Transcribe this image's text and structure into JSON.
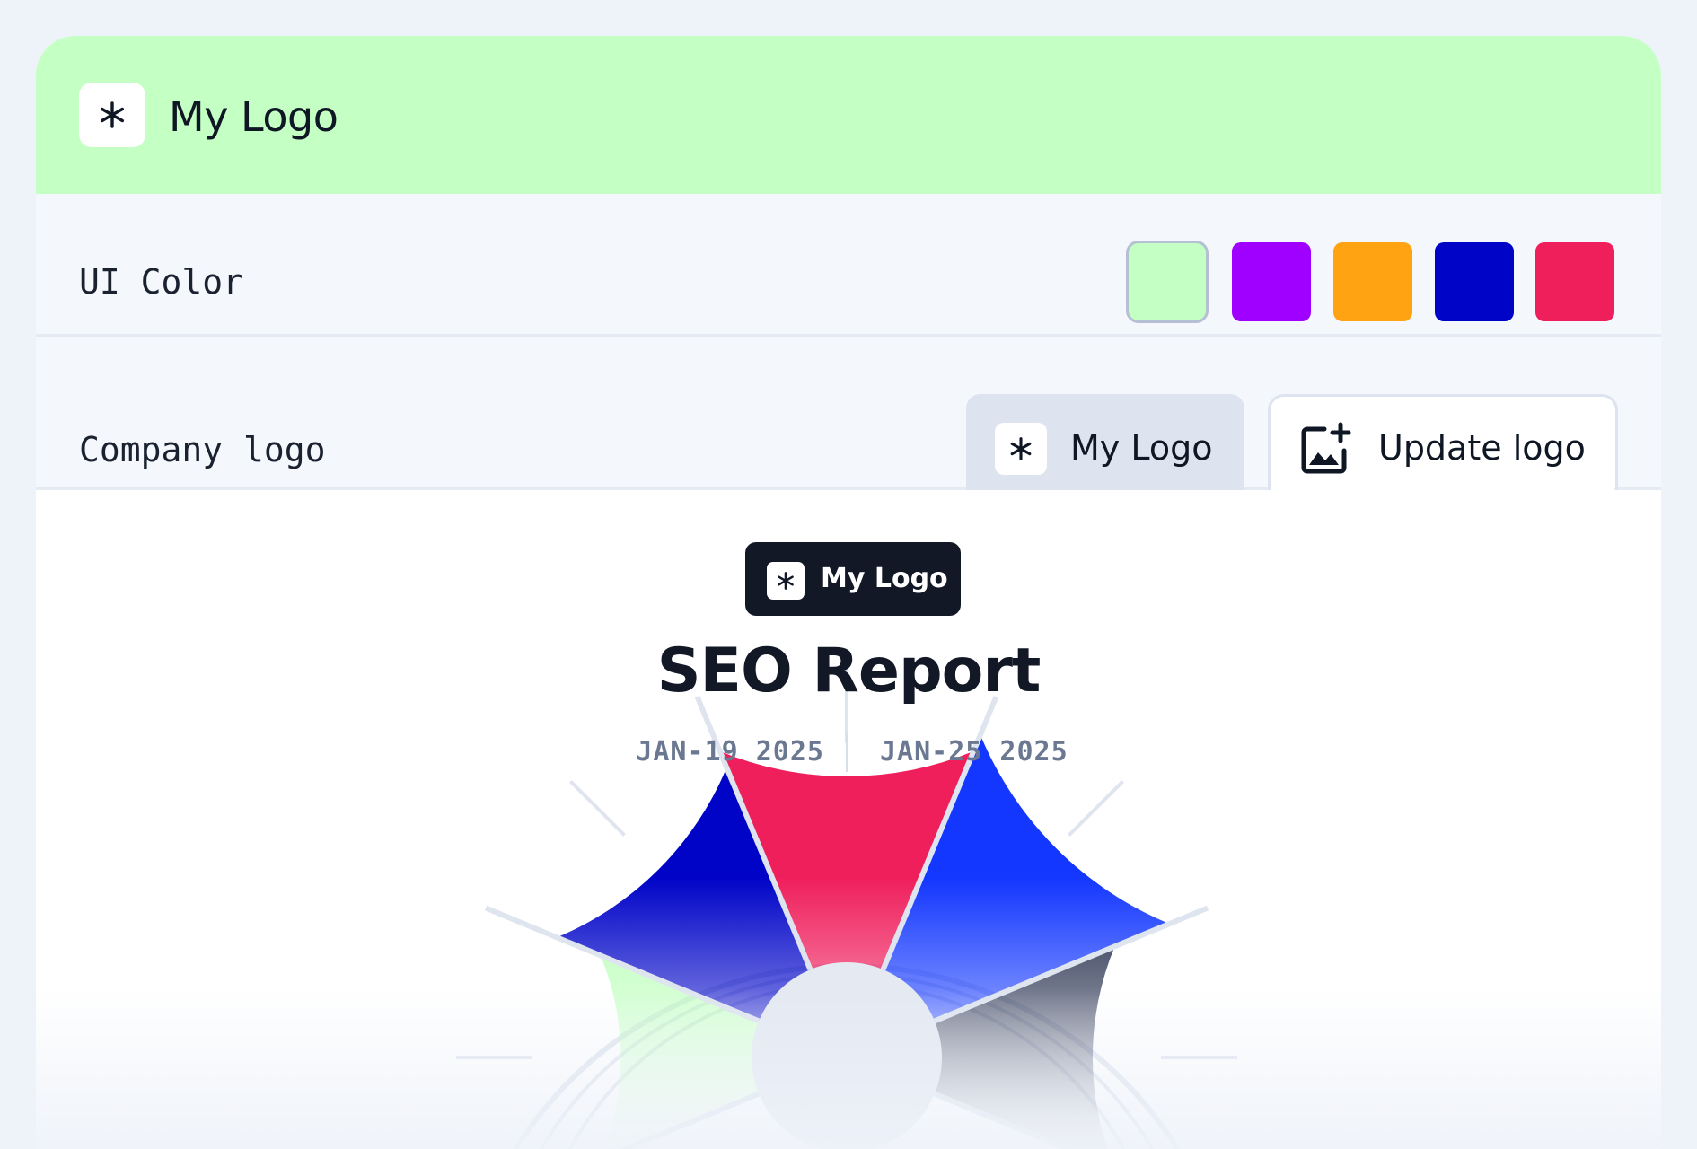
{
  "header": {
    "logo_icon": "asterisk-icon",
    "title": "My Logo",
    "background": "#c4ffc4"
  },
  "ui_color": {
    "label": "UI Color",
    "swatches": [
      {
        "color": "#c4ffc4",
        "selected": true
      },
      {
        "color": "#a000ff",
        "selected": false
      },
      {
        "color": "#ffa313",
        "selected": false
      },
      {
        "color": "#0004c7",
        "selected": false
      },
      {
        "color": "#ef1f5c",
        "selected": false
      }
    ]
  },
  "company_logo": {
    "label": "Company logo",
    "current_logo_label": "My Logo",
    "update_button_label": "Update logo",
    "update_icon": "image-add-icon"
  },
  "preview": {
    "badge_label": "My Logo",
    "title": "SEO Report",
    "date_start": "JAN-19 2025",
    "date_end": "JAN-25 2025"
  },
  "chart_data": {
    "type": "pie",
    "variant": "polar-area-semicircle",
    "series": [
      {
        "color": "#b7ffb6",
        "value": 0.58
      },
      {
        "color": "#0004c7",
        "value": 0.74
      },
      {
        "color": "#ef1f5c",
        "value": 0.8
      },
      {
        "color": "#1337fe",
        "value": 0.86
      },
      {
        "color": "#1a2444",
        "value": 0.66
      }
    ],
    "rings": 3,
    "grid": true
  }
}
